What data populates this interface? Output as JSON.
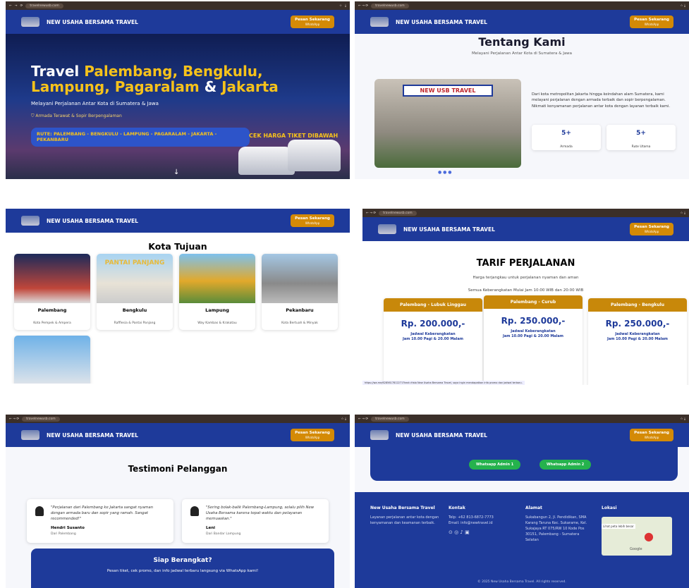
{
  "common": {
    "url": "travelnewusb.com",
    "brand": "NEW USAHA BERSAMA TRAVEL",
    "cta_label": "Pesan Sekarang",
    "cta_sub": "WhatsApp"
  },
  "hero": {
    "title_1": "Travel ",
    "title_2": "Palembang, Bengkulu,",
    "title_3": "Lampung, Pagaralam",
    "title_4": " & ",
    "title_5": "Jakarta",
    "subtitle": "Melayani Perjalanan Antar Kota di Sumatera & Jawa",
    "feature": "Armada Terawat & Sopir Berpengalaman",
    "route": "RUTE: PALEMBANG - BENGKULU - LAMPUNG - PAGARALAM - JAKARTA - PEKANBARU",
    "promo": "CEK HARGA TIKET DIBAWAH",
    "scroll_icon": "↓"
  },
  "about": {
    "title": "Tentang Kami",
    "lead": "Melayani Perjalanan Antar Kota di Sumatera & Jawa",
    "sign": "NEW USB TRAVEL",
    "text": "Dari kota metropolitan Jakarta hingga keindahan alam Sumatera, kami melayani perjalanan dengan armada terbaik dan sopir berpengalaman. Nikmati kenyamanan perjalanan antar kota dengan layanan terbaik kami.",
    "stats": [
      {
        "value": "5+",
        "label": "Armada"
      },
      {
        "value": "5+",
        "label": "Rute Utama"
      }
    ]
  },
  "kota": {
    "title": "Kota Tujuan",
    "cities": [
      {
        "name": "Palembang",
        "desc": "Kota Pempek & Ampera"
      },
      {
        "name": "Bengkulu",
        "desc": "Rafflesia & Pantai Panjang"
      },
      {
        "name": "Lampung",
        "desc": "Way Kambas & Krakatau"
      },
      {
        "name": "Pekanbaru",
        "desc": "Kota Bertuah & Minyak"
      }
    ],
    "banner": "PANTAI PANJANG"
  },
  "tarif": {
    "title": "TARIF PERJALANAN",
    "line1": "Harga terjangkau untuk perjalanan nyaman dan aman",
    "line2": "Semua Keberangkatan Mulai Jam 10:00 WIB dan 20:00 WIB",
    "plans": [
      {
        "route": "Palembang - Lubuk Linggau",
        "price": "Rp. 200.000,-",
        "sched1": "Jadwal Keberangkatan",
        "sched2": "Jam 10.00 Pagi & 20.00 Malam"
      },
      {
        "route": "Palembang - Curub",
        "price": "Rp. 250.000,-",
        "sched1": "Jadwal Keberangkatan",
        "sched2": "Jam 10.00 Pagi & 20.00 Malam"
      },
      {
        "route": "Palembang - Bengkulu",
        "price": "Rp. 250.000,-",
        "sched1": "Jadwal Keberangkatan",
        "sched2": "Jam 10.00 Pagi & 20.00 Malam"
      }
    ],
    "status": "https://wa.me/6285617812271?text=Halo New Usaha Bersama Travel, saya ingin mendapatkan info promo dan jadwal terbaru."
  },
  "testi": {
    "title": "Testimoni Pelanggan",
    "items": [
      {
        "quote": "\"Perjalanan dari Palembang ke Jakarta sangat nyaman dengan armada baru dan sopir yang ramah. Sangat recommended!\"",
        "name": "Hendri Susanto",
        "from": "Dari Palembang"
      },
      {
        "quote": "\"Sering bolak-balik Palembang-Lampung, selalu pilih New Usaha Bersama karena tepat waktu dan pelayanan memuaskan.\"",
        "name": "Leni",
        "from": "Dari Bandar Lampung"
      }
    ],
    "cta_title": "Siap Berangkat?",
    "cta_text": "Pesan tiket, cek promo, dan info jadwal terbaru langsung via WhatsApp kami!"
  },
  "footer": {
    "wa1": "Whatsapp Admin 1",
    "wa2": "Whatsapp Admin 2",
    "brand": "New Usaha Bersama Travel",
    "brand_text": "Layanan perjalanan antar kota dengan kenyamanan dan keamanan terbaik.",
    "kontak_title": "Kontak",
    "telp": "Telp: +62 813-6872-7773",
    "email": "Email: info@newtravel.id",
    "alamat_title": "Alamat",
    "alamat": "Sukabangun 2, Jl. Pendidikan, SMA Karang Taruna Kec. Sukarame, Kel. Sukajaya RT 075/RW 10 Kode Pos 30151, Palembang - Sumatera Selatan",
    "lokasi_title": "Lokasi",
    "map_link": "Lihat peta lebih besar",
    "map_brand": "Google",
    "copyright": "© 2025 New Usaha Bersama Travel. All rights reserved."
  }
}
